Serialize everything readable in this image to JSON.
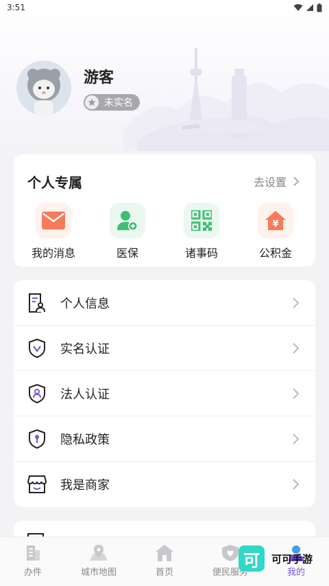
{
  "status_bar": {
    "time": "3:51"
  },
  "profile": {
    "username": "游客",
    "verify_status": "未实名"
  },
  "personal": {
    "title": "个人专属",
    "settings_link": "去设置",
    "items": [
      {
        "label": "我的消息",
        "icon": "envelope-icon",
        "color": "#f77b5a"
      },
      {
        "label": "医保",
        "icon": "medical-insurance-icon",
        "color": "#3fbf72"
      },
      {
        "label": "诸事码",
        "icon": "qr-code-icon",
        "color": "#3fbf72"
      },
      {
        "label": "公积金",
        "icon": "house-fund-icon",
        "color": "#f77b5a"
      }
    ]
  },
  "menu": {
    "items": [
      {
        "label": "个人信息",
        "icon": "profile-document-icon"
      },
      {
        "label": "实名认证",
        "icon": "shield-v-icon"
      },
      {
        "label": "法人认证",
        "icon": "shield-person-icon"
      },
      {
        "label": "隐私政策",
        "icon": "shield-keyhole-icon"
      },
      {
        "label": "我是商家",
        "icon": "store-icon"
      }
    ]
  },
  "nav": {
    "items": [
      {
        "label": "办件",
        "icon": "building-icon"
      },
      {
        "label": "城市地图",
        "icon": "map-pin-icon"
      },
      {
        "label": "首页",
        "icon": "home-icon"
      },
      {
        "label": "便民服务",
        "icon": "heart-shield-icon"
      },
      {
        "label": "我的",
        "icon": "user-icon"
      }
    ],
    "active_index": 4
  },
  "watermark": {
    "logo": "可",
    "text": "可可手游"
  },
  "colors": {
    "accent": "#7a55d6",
    "badge_gray": "#a8a8ad"
  }
}
